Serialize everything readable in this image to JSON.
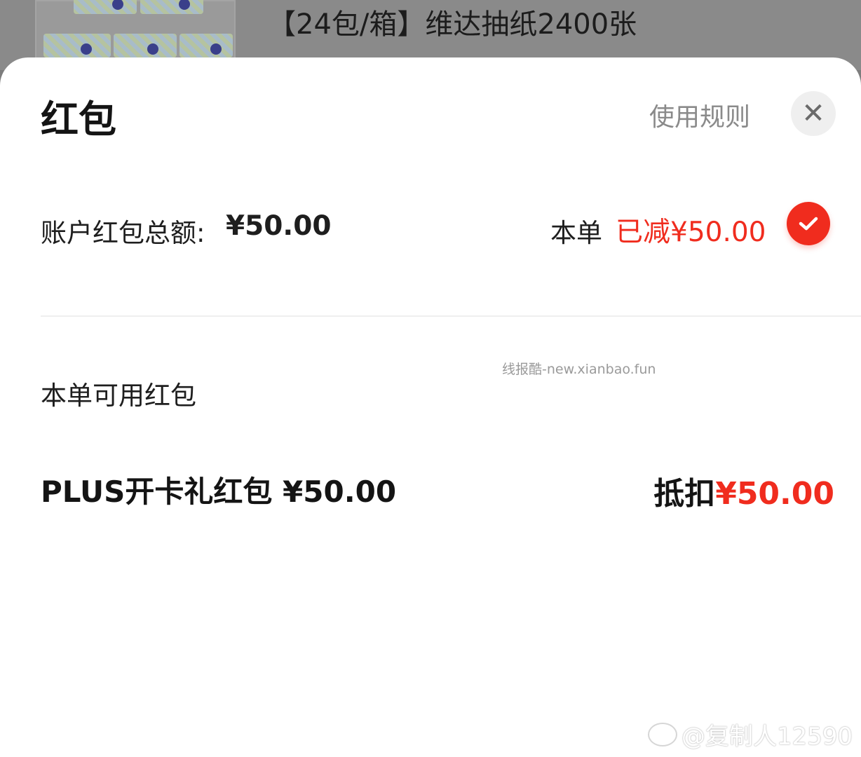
{
  "background_product": {
    "title": "【24包/箱】维达抽纸2400张"
  },
  "sheet": {
    "title": "红包",
    "rules_link": "使用规则",
    "close_icon": "close-icon"
  },
  "summary": {
    "total_label": "账户红包总额:",
    "total_amount": "¥50.00",
    "deduct_prefix": "本单",
    "deduct_value": "已减¥50.00",
    "checked": true
  },
  "available": {
    "section_label": "本单可用红包",
    "items": [
      {
        "name": "PLUS开卡礼红包 ¥50.00",
        "deduct_label": "抵扣",
        "deduct_amount": "¥50.00"
      }
    ]
  },
  "watermarks": {
    "site": "线报酷-new.xianbao.fun",
    "weibo": "@复制人12590"
  },
  "colors": {
    "accent_red": "#f02c1e",
    "overlay_dim": "#7d7d7d"
  }
}
